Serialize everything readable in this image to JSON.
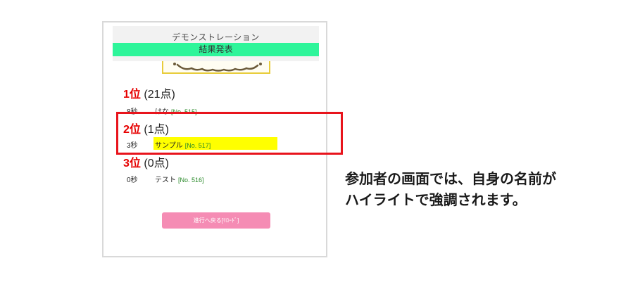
{
  "header": {
    "title": "デモンストレーション",
    "result_label": "結果発表"
  },
  "rankings": [
    {
      "place": "1位",
      "score": "(21点)",
      "time": "8秒",
      "name": "はな",
      "number": "[No. 515]",
      "highlighted": false
    },
    {
      "place": "2位",
      "score": "(1点)",
      "time": "3秒",
      "name": "サンプル",
      "number": "[No. 517]",
      "highlighted": true
    },
    {
      "place": "3位",
      "score": "(0点)",
      "time": "0秒",
      "name": "テスト",
      "number": "[No. 516]",
      "highlighted": false
    }
  ],
  "reload_button": {
    "label": "進行へ戻る[ﾘﾛｰﾄﾞ]"
  },
  "caption": {
    "line1": "参加者の画面では、自身の名前が",
    "line2": "ハイライトで強調されます。"
  },
  "colors": {
    "result_bar": "#2ef59a",
    "rank_place": "#e60000",
    "highlight_fill": "#ffff00",
    "highlight_border": "#e8141c",
    "reload_button": "#f58cb4",
    "number_text": "#2a8a2a"
  }
}
